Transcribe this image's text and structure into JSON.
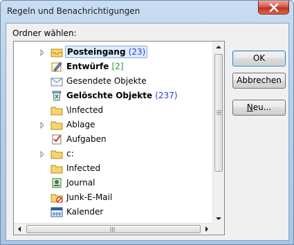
{
  "window": {
    "title": "Regeln und Benachrichtigungen"
  },
  "folder_label": "Ordner wählen:",
  "buttons": {
    "ok": "OK",
    "cancel": "Abbrechen",
    "new": "Neu..."
  },
  "folders": [
    {
      "name": "Posteingang",
      "count": "(23)",
      "bold": true,
      "count_color": "#2a3bd6",
      "expandable": true,
      "selected": true,
      "icon": "inbox-icon"
    },
    {
      "name": "Entwürfe",
      "count": "[2]",
      "bold": true,
      "count_color": "#1f9b2a",
      "expandable": false,
      "icon": "drafts-icon"
    },
    {
      "name": "Gesendete Objekte",
      "count": "",
      "bold": false,
      "expandable": false,
      "icon": "sent-icon"
    },
    {
      "name": "Gelöschte Objekte",
      "count": "(237)",
      "bold": true,
      "count_color": "#2a3bd6",
      "expandable": false,
      "icon": "trash-icon"
    },
    {
      "name": "\\Infected",
      "count": "",
      "bold": false,
      "expandable": false,
      "icon": "folder-icon"
    },
    {
      "name": "Ablage",
      "count": "",
      "bold": false,
      "expandable": true,
      "icon": "folder-icon"
    },
    {
      "name": "Aufgaben",
      "count": "",
      "bold": false,
      "expandable": false,
      "icon": "tasks-icon"
    },
    {
      "name": "c:",
      "count": "",
      "bold": false,
      "expandable": true,
      "icon": "folder-icon"
    },
    {
      "name": "Infected",
      "count": "",
      "bold": false,
      "expandable": false,
      "icon": "folder-icon"
    },
    {
      "name": "Journal",
      "count": "",
      "bold": false,
      "expandable": false,
      "icon": "journal-icon"
    },
    {
      "name": "Junk-E-Mail",
      "count": "",
      "bold": false,
      "expandable": false,
      "icon": "junk-icon"
    },
    {
      "name": "Kalender",
      "count": "",
      "bold": false,
      "expandable": false,
      "icon": "calendar-icon"
    }
  ],
  "colors": {
    "accent": "#3c7fb1",
    "selection": "#dcecfc"
  }
}
